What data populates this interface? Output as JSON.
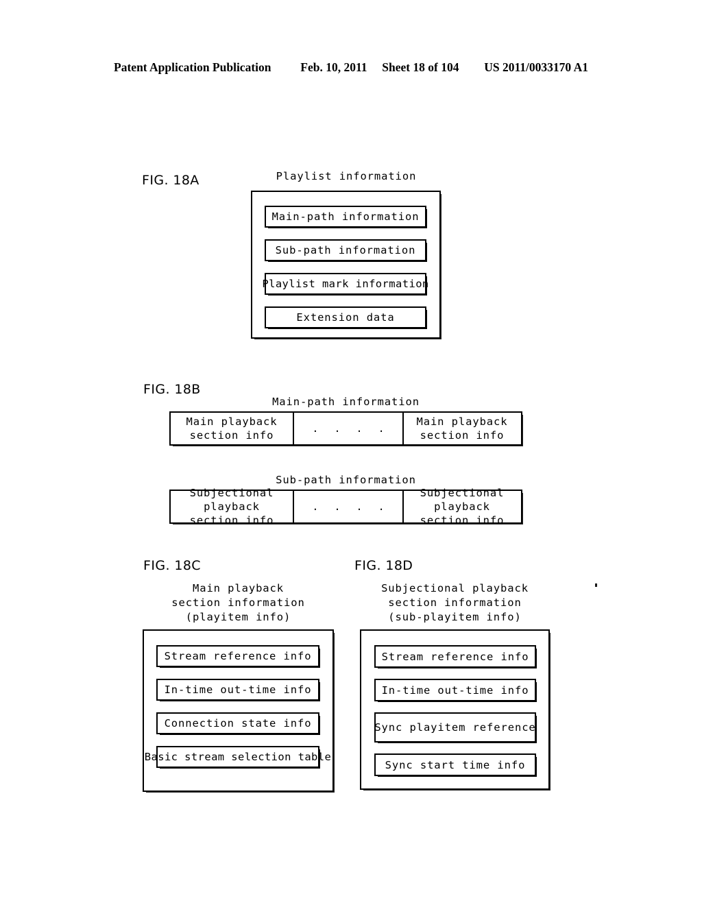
{
  "header": {
    "publication": "Patent Application Publication",
    "date": "Feb. 10, 2011",
    "sheet": "Sheet 18 of 104",
    "number": "US 2011/0033170 A1"
  },
  "figures": {
    "a": {
      "label": "FIG. 18A",
      "caption": "Playlist information",
      "items": [
        "Main-path information",
        "Sub-path information",
        "Playlist mark information",
        "Extension data"
      ]
    },
    "b": {
      "label": "FIG. 18B",
      "tables": [
        {
          "caption": "Main-path information",
          "cells": [
            "Main playback\nsection info",
            ". . . .",
            "Main playback\nsection info"
          ]
        },
        {
          "caption": "Sub-path information",
          "cells": [
            "Subjectional playback\nsection info",
            ". . . .",
            "Subjectional playback\nsection info"
          ]
        }
      ]
    },
    "c": {
      "label": "FIG. 18C",
      "caption_line1": "Main playback",
      "caption_line2": "section information",
      "caption_line3": "(playitem info)",
      "items": [
        "Stream reference info",
        "In-time out-time info",
        "Connection state info",
        "Basic stream selection table"
      ]
    },
    "d": {
      "label": "FIG. 18D",
      "caption_line1": "Subjectional playback",
      "caption_line2": "section information",
      "caption_line3": "(sub-playitem info)",
      "items": [
        "Stream reference info",
        "In-time out-time info",
        "Sync playitem reference",
        "Sync start time info"
      ]
    }
  },
  "colors": {
    "ink": "#000000",
    "paper": "#ffffff"
  }
}
